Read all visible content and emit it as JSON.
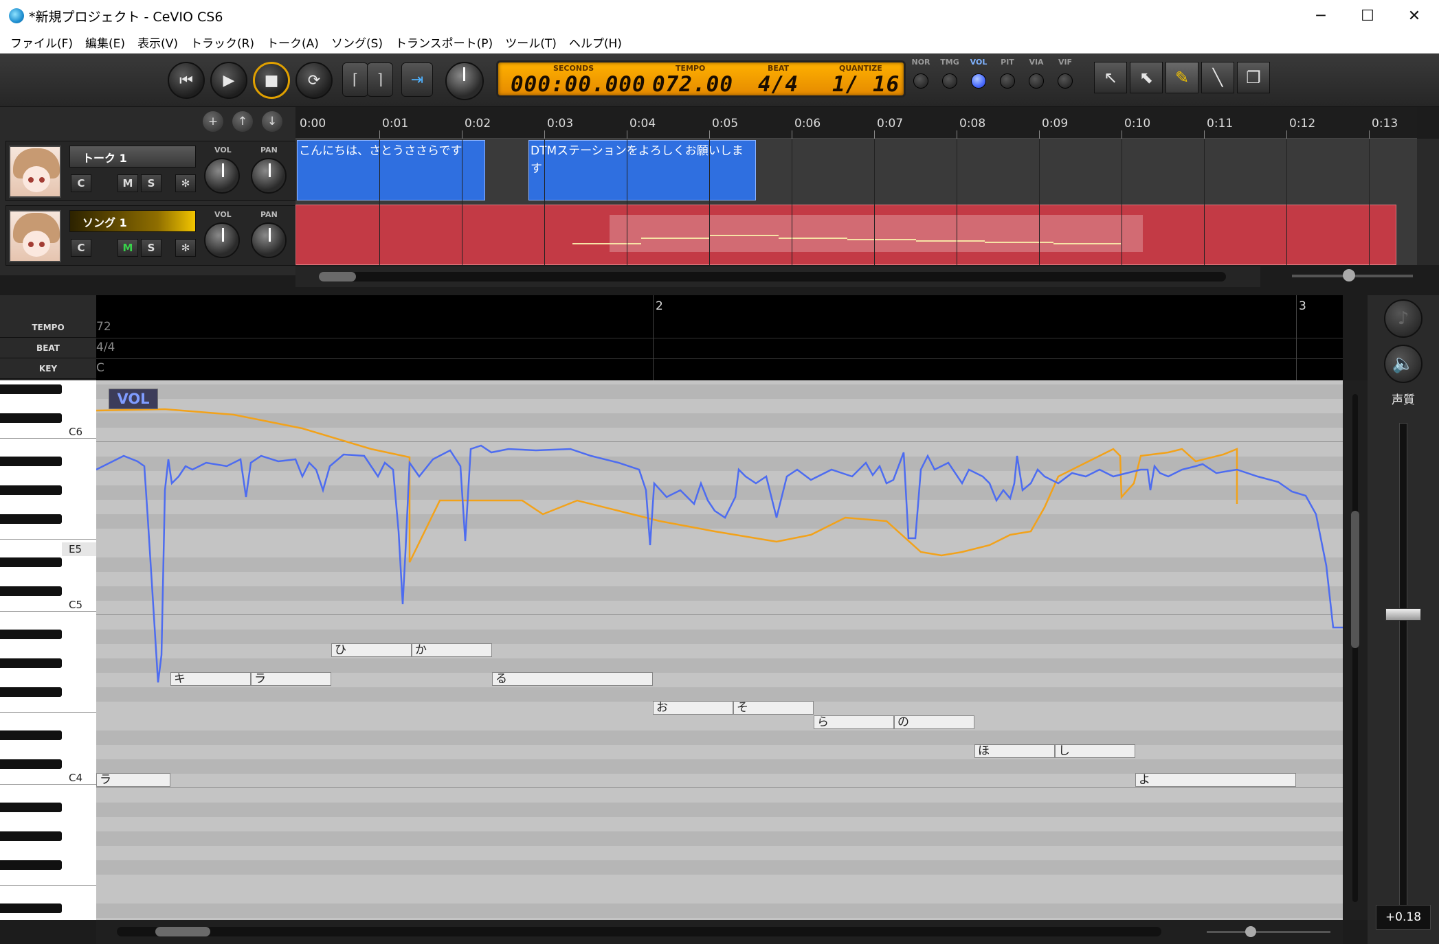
{
  "window": {
    "title": "*新規プロジェクト - CeVIO CS6",
    "minimize": "─",
    "maximize": "☐",
    "close": "✕"
  },
  "menu": [
    "ファイル(F)",
    "編集(E)",
    "表示(V)",
    "トラック(R)",
    "トーク(A)",
    "ソング(S)",
    "トランスポート(P)",
    "ツール(T)",
    "ヘルプ(H)"
  ],
  "transport": {
    "lcd": {
      "seconds_label": "SECONDS",
      "seconds": "000:00.000",
      "tempo_label": "TEMPO",
      "tempo": "072.00",
      "beat_label": "BEAT",
      "beat": "4/4",
      "quantize_label": "QUANTIZE",
      "quantize": "1/ 16"
    },
    "modes": [
      {
        "label": "NOR",
        "on": false
      },
      {
        "label": "TMG",
        "on": false
      },
      {
        "label": "VOL",
        "on": true
      },
      {
        "label": "PIT",
        "on": false
      },
      {
        "label": "VIA",
        "on": false
      },
      {
        "label": "VIF",
        "on": false
      }
    ]
  },
  "timeline": {
    "ticks": [
      "0:00",
      "0:01",
      "0:02",
      "0:03",
      "0:04",
      "0:05",
      "0:06",
      "0:07",
      "0:08",
      "0:09",
      "0:10",
      "0:11",
      "0:12",
      "0:13"
    ]
  },
  "tracks": [
    {
      "name": "トーク 1",
      "type": "talk",
      "vol_label": "VOL",
      "pan_label": "PAN",
      "btn_c": "C",
      "btn_m": "M",
      "btn_s": "S",
      "clips": [
        {
          "text": "こんにちは、さとうささらです"
        },
        {
          "text": "DTMステーションをよろしくお願いします"
        }
      ]
    },
    {
      "name": "ソング 1",
      "type": "song",
      "vol_label": "VOL",
      "pan_label": "PAN",
      "btn_c": "C",
      "btn_m": "M",
      "btn_s": "S"
    }
  ],
  "conductor": {
    "tempo_label": "TEMPO",
    "tempo_value": "72",
    "beat_label": "BEAT",
    "beat_value": "4/4",
    "key_label": "KEY",
    "key_value": "C",
    "measure_2": "2",
    "measure_3": "3"
  },
  "piano": {
    "c6": "C6",
    "e5": "E5",
    "c5": "C5",
    "c4": "C4"
  },
  "notes": [
    {
      "lyric": "ラ"
    },
    {
      "lyric": "キ"
    },
    {
      "lyric": "ラ"
    },
    {
      "lyric": "ひ"
    },
    {
      "lyric": "か"
    },
    {
      "lyric": "る"
    },
    {
      "lyric": "お"
    },
    {
      "lyric": "そ"
    },
    {
      "lyric": "ら"
    },
    {
      "lyric": "の"
    },
    {
      "lyric": "ほ"
    },
    {
      "lyric": "し"
    },
    {
      "lyric": "よ"
    }
  ],
  "editor": {
    "mode_badge": "VOL"
  },
  "side": {
    "voice_quality": "声質",
    "value": "+0.18"
  },
  "colors": {
    "pitch_line": "#4d6cf0",
    "volume_line": "#f2a21a",
    "talk_clip": "#2f6fe0",
    "song_clip": "#c33a45"
  }
}
